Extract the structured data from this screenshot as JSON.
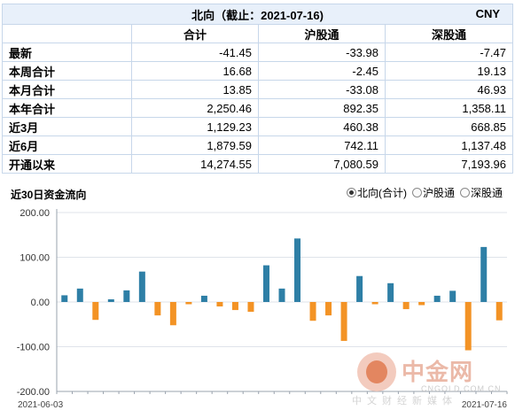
{
  "table": {
    "title": "北向（截止：2021-07-16)",
    "unit": "CNY",
    "columns": [
      "合计",
      "沪股通",
      "深股通"
    ],
    "rows": [
      {
        "label": "最新",
        "values": [
          "-41.45",
          "-33.98",
          "-7.47"
        ]
      },
      {
        "label": "本周合计",
        "values": [
          "16.68",
          "-2.45",
          "19.13"
        ]
      },
      {
        "label": "本月合计",
        "values": [
          "13.85",
          "-33.08",
          "46.93"
        ]
      },
      {
        "label": "本年合计",
        "values": [
          "2,250.46",
          "892.35",
          "1,358.11"
        ]
      },
      {
        "label": "近3月",
        "values": [
          "1,129.23",
          "460.38",
          "668.85"
        ]
      },
      {
        "label": "近6月",
        "values": [
          "1,879.59",
          "742.11",
          "1,137.48"
        ]
      },
      {
        "label": "开通以来",
        "values": [
          "14,274.55",
          "7,080.59",
          "7,193.96"
        ]
      }
    ]
  },
  "chart_section": {
    "title": "近30日资金流向",
    "legend": [
      {
        "label": "北向(合计)",
        "selected": true
      },
      {
        "label": "沪股通",
        "selected": false
      },
      {
        "label": "深股通",
        "selected": false
      }
    ]
  },
  "colors": {
    "positive": "#2e7fa6",
    "negative": "#f39325",
    "grid": "#dfe3ea",
    "axis": "#9aa3ae"
  },
  "chart_data": {
    "type": "bar",
    "title": "近30日资金流向",
    "x_start_label": "2021-06-03",
    "x_end_label": "2021-07-16",
    "values": [
      15,
      30,
      -40,
      6,
      26,
      68,
      -30,
      -52,
      -5,
      14,
      -10,
      -18,
      -22,
      82,
      30,
      142,
      -42,
      -30,
      -87,
      58,
      -5,
      42,
      -16,
      -7,
      14,
      25,
      -108,
      123,
      -41
    ],
    "yticks": [
      "200.00",
      "100.00",
      "0.00",
      "-100.00",
      "-200.00"
    ],
    "ylim": [
      -200,
      200
    ],
    "grid": true,
    "legend_position": "top-right"
  },
  "watermark": {
    "brand": "中金网",
    "site": "CNGOLD.COM.CN",
    "slogan": "中文财经新媒体"
  }
}
